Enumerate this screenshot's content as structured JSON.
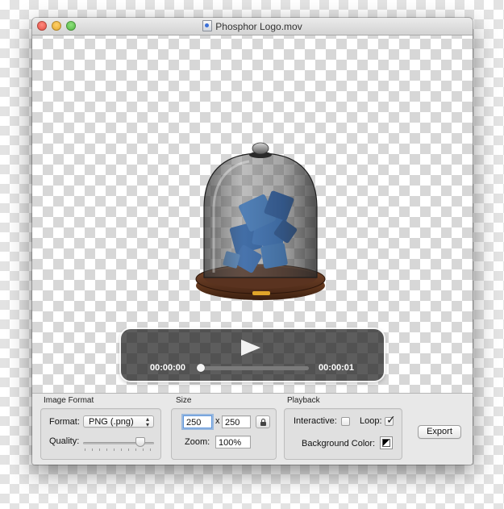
{
  "window": {
    "title": "Phosphor Logo.mov"
  },
  "player": {
    "time_elapsed": "00:00:00",
    "time_total": "00:00:01",
    "progress": 0
  },
  "image_format": {
    "group_label": "Image Format",
    "format_label": "Format:",
    "format_value": "PNG (.png)",
    "quality_label": "Quality:",
    "quality_level": 0.85
  },
  "size": {
    "group_label": "Size",
    "width": "250",
    "times": "x",
    "height": "250",
    "zoom_label": "Zoom:",
    "zoom_value": "100%"
  },
  "playback": {
    "group_label": "Playback",
    "interactive_label": "Interactive:",
    "interactive_checked": false,
    "loop_label": "Loop:",
    "loop_checked": true,
    "background_color_label": "Background Color:"
  },
  "actions": {
    "export_label": "Export"
  },
  "colors": {
    "accent_focus": "#5f97dd",
    "cube_blue": "#2f7fe6",
    "wood": "#5a3320"
  },
  "icons": {
    "title_icon": "movie-document-icon",
    "play": "play-icon",
    "lock": "lock-icon"
  }
}
